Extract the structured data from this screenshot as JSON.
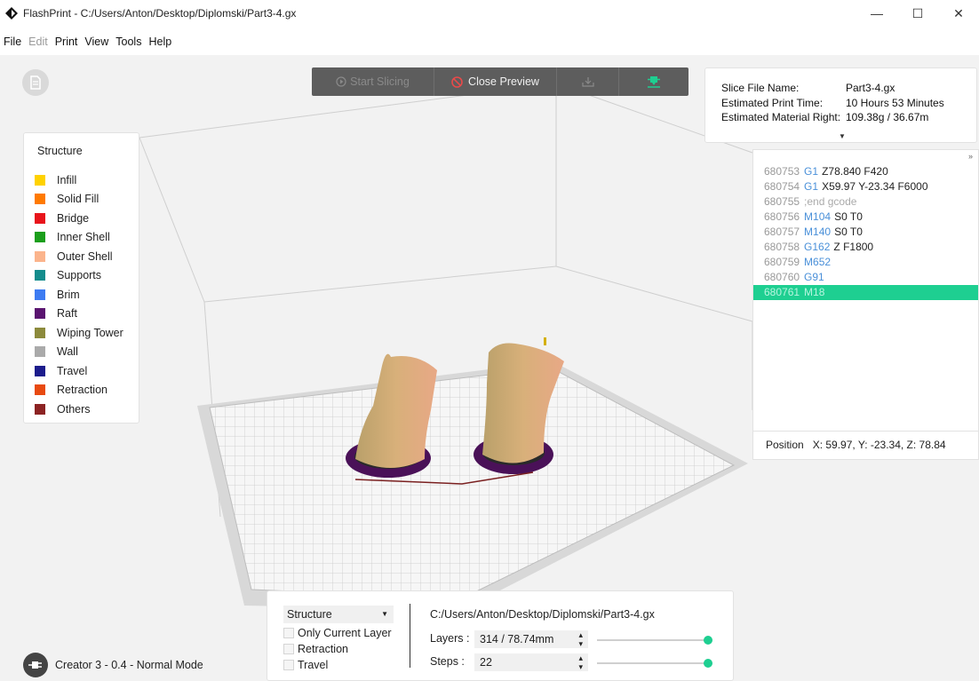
{
  "window": {
    "title": "FlashPrint - C:/Users/Anton/Desktop/Diplomski/Part3-4.gx",
    "minimize_glyph": "—",
    "maximize_glyph": "☐",
    "close_glyph": "✕"
  },
  "menu": {
    "items": [
      {
        "label": "File",
        "enabled": true
      },
      {
        "label": "Edit",
        "enabled": false
      },
      {
        "label": "Print",
        "enabled": true
      },
      {
        "label": "View",
        "enabled": true
      },
      {
        "label": "Tools",
        "enabled": true
      },
      {
        "label": "Help",
        "enabled": true
      }
    ]
  },
  "toolbar": {
    "start_slicing_label": "Start Slicing",
    "close_preview_label": "Close Preview"
  },
  "slice_info": {
    "file_name_label": "Slice File Name:",
    "file_name_value": "Part3-4.gx",
    "print_time_label": "Estimated Print Time:",
    "print_time_value": "10 Hours 53 Minutes",
    "material_label": "Estimated Material Right:",
    "material_value": "109.38g / 36.67m"
  },
  "gcode": {
    "expand_glyph": "»",
    "lines": [
      {
        "num": "680753",
        "cmd": "G1",
        "args": "Z78.840 F420",
        "comment": ""
      },
      {
        "num": "680754",
        "cmd": "G1",
        "args": "X59.97 Y-23.34 F6000",
        "comment": ""
      },
      {
        "num": "680755",
        "cmd": "",
        "args": "",
        "comment": ";end gcode"
      },
      {
        "num": "680756",
        "cmd": "M104",
        "args": "S0 T0",
        "comment": ""
      },
      {
        "num": "680757",
        "cmd": "M140",
        "args": "S0 T0",
        "comment": ""
      },
      {
        "num": "680758",
        "cmd": "G162",
        "args": "Z F1800",
        "comment": ""
      },
      {
        "num": "680759",
        "cmd": "M652",
        "args": "",
        "comment": ""
      },
      {
        "num": "680760",
        "cmd": "G91",
        "args": "",
        "comment": ""
      },
      {
        "num": "680761",
        "cmd": "M18",
        "args": "",
        "comment": "",
        "selected": true
      }
    ],
    "position_label": "Position",
    "position_value": "X: 59.97, Y: -23.34, Z: 78.84"
  },
  "legend": {
    "title": "Structure",
    "items": [
      {
        "label": "Infill",
        "color": "#FFD200"
      },
      {
        "label": "Solid Fill",
        "color": "#FF7A00"
      },
      {
        "label": "Bridge",
        "color": "#E8141B"
      },
      {
        "label": "Inner Shell",
        "color": "#1B9E1B"
      },
      {
        "label": "Outer Shell",
        "color": "#FBB48C"
      },
      {
        "label": "Supports",
        "color": "#148C8C"
      },
      {
        "label": "Brim",
        "color": "#3D7BF2"
      },
      {
        "label": "Raft",
        "color": "#5A1470"
      },
      {
        "label": "Wiping Tower",
        "color": "#8C8A3C"
      },
      {
        "label": "Wall",
        "color": "#AAAAAA"
      },
      {
        "label": "Travel",
        "color": "#1C1C8C"
      },
      {
        "label": "Retraction",
        "color": "#E84A10"
      },
      {
        "label": "Others",
        "color": "#8C2323"
      }
    ]
  },
  "controls": {
    "structure_select": "Structure",
    "only_current_layer_label": "Only Current Layer",
    "retraction_label": "Retraction",
    "travel_label": "Travel",
    "file_path": "C:/Users/Anton/Desktop/Diplomski/Part3-4.gx",
    "layers_label": "Layers :",
    "layers_value": "314 / 78.74mm",
    "layers_slider_fraction": 1.0,
    "steps_label": "Steps :",
    "steps_value": "22",
    "steps_slider_fraction": 1.0
  },
  "status": {
    "machine": "Creator 3 - 0.4 - Normal Mode"
  },
  "colors": {
    "accent": "#1ECF91",
    "gcode_cmd": "#4A90D9",
    "toolbar_bg": "#5D5D5D"
  }
}
